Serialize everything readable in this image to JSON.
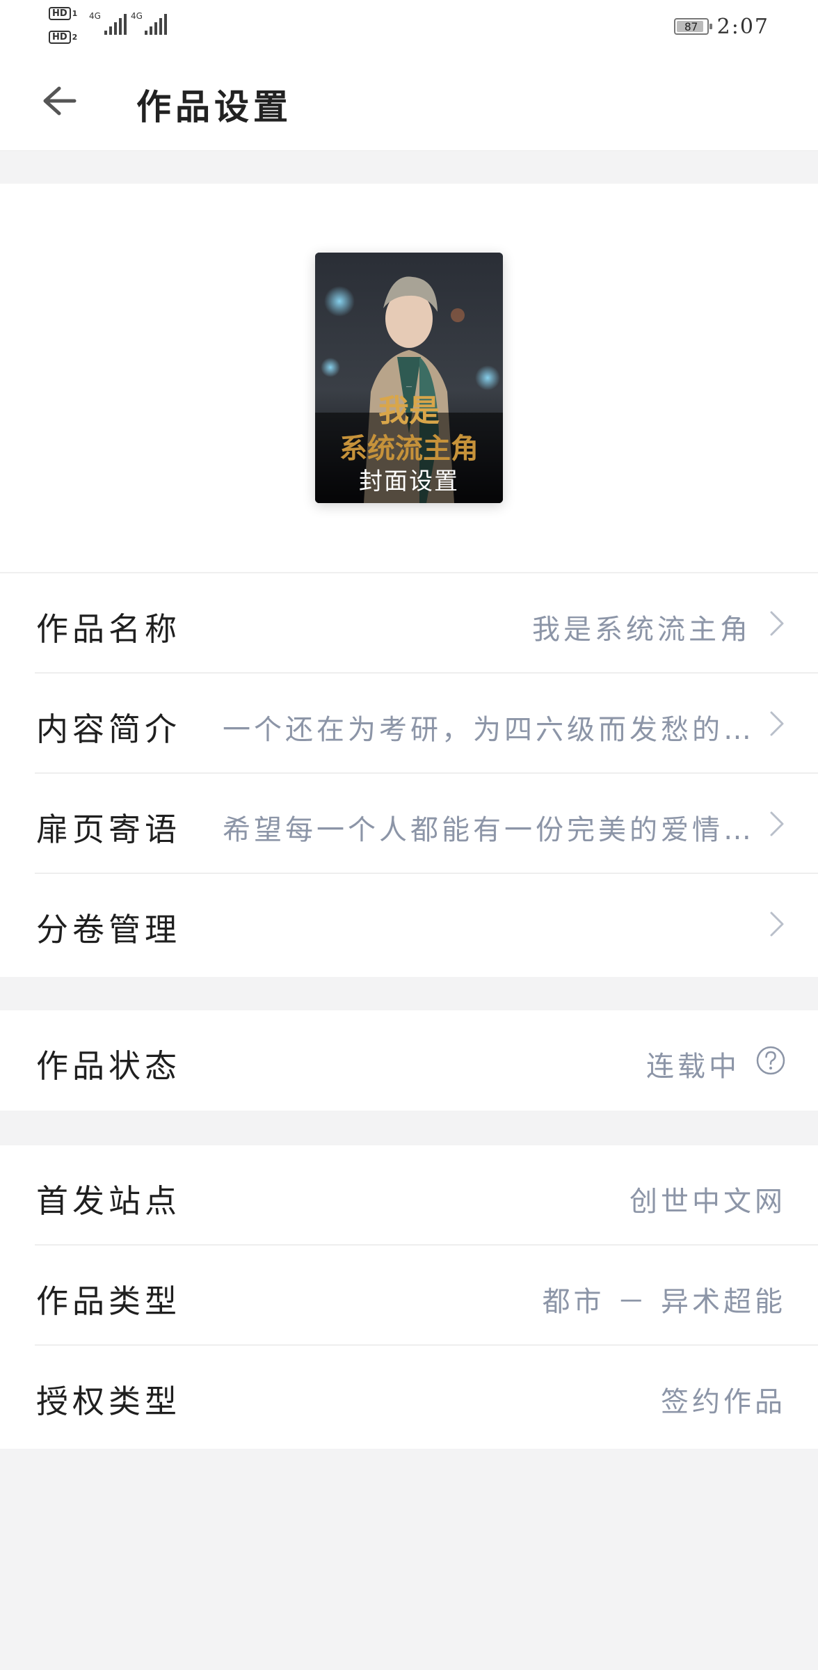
{
  "status_bar": {
    "hd1": "HD",
    "hd1_sub": "1",
    "hd2": "HD",
    "hd2_sub": "2",
    "net1": "4G",
    "net2": "4G",
    "battery": "87",
    "time": "2:07"
  },
  "nav": {
    "title": "作品设置",
    "back_icon": "arrow-left-icon"
  },
  "cover": {
    "caption": "封面设置"
  },
  "group1": [
    {
      "label": "作品名称",
      "value": "我是系统流主角",
      "icon": "chevron-right-icon"
    },
    {
      "label": "内容简介",
      "value": "一个还在为考研，为四六级而发愁的…",
      "icon": "chevron-right-icon"
    },
    {
      "label": "扉页寄语",
      "value": "希望每一个人都能有一份完美的爱情…",
      "icon": "chevron-right-icon"
    },
    {
      "label": "分卷管理",
      "value": "",
      "icon": "chevron-right-icon"
    }
  ],
  "group2": [
    {
      "label": "作品状态",
      "value": "连载中",
      "icon": "help-circle-icon"
    }
  ],
  "group3": [
    {
      "label": "首发站点",
      "value": "创世中文网"
    },
    {
      "label": "作品类型",
      "value": "都市 － 异术超能"
    },
    {
      "label": "授权类型",
      "value": "签约作品"
    }
  ],
  "colors": {
    "value_text": "#8c95a7",
    "background": "#f3f3f4"
  }
}
